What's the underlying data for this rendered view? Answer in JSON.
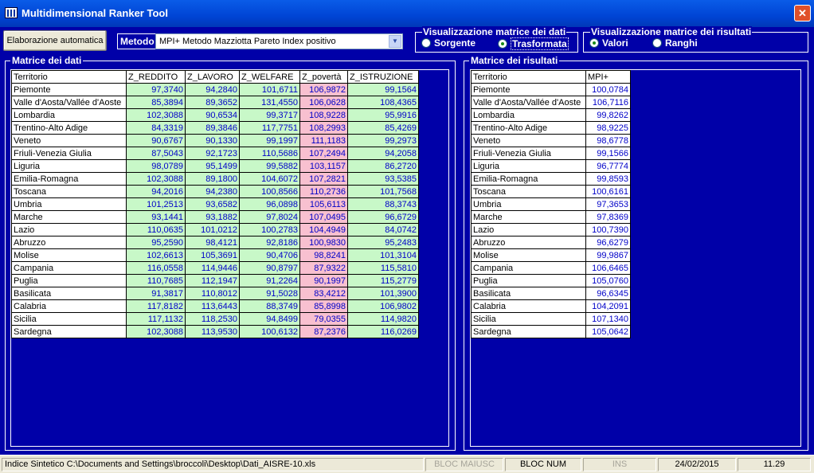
{
  "window": {
    "title": "Multidimensional Ranker Tool",
    "close_glyph": "✕"
  },
  "toolbar": {
    "auto_button": "Elaborazione automatica",
    "method_label": "Metodo",
    "method_value": "MPI+ Metodo Mazziotta Pareto Index positivo",
    "combo_arrow": "▼"
  },
  "view_data": {
    "title": "Visualizzazione matrice dei dati",
    "options": [
      {
        "label": "Sorgente",
        "selected": false
      },
      {
        "label": "Trasformata",
        "selected": true
      }
    ]
  },
  "view_results": {
    "title": "Visualizzazione matrice dei risultati",
    "options": [
      {
        "label": "Valori",
        "selected": true
      },
      {
        "label": "Ranghi",
        "selected": false
      }
    ]
  },
  "data_matrix": {
    "title": "Matrice dei dati",
    "headers": [
      "Territorio",
      "Z_REDDITO",
      "Z_LAVORO",
      "Z_WELFARE",
      "Z_povertà",
      "Z_ISTRUZIONE"
    ],
    "rows": [
      [
        "Piemonte",
        "97,3740",
        "94,2840",
        "101,6711",
        "106,9872",
        "99,1564"
      ],
      [
        "Valle d'Aosta/Vallée d'Aoste",
        "85,3894",
        "89,3652",
        "131,4550",
        "106,0628",
        "108,4365"
      ],
      [
        "Lombardia",
        "102,3088",
        "90,6534",
        "99,3717",
        "108,9228",
        "95,9916"
      ],
      [
        "Trentino-Alto Adige",
        "84,3319",
        "89,3846",
        "117,7751",
        "108,2993",
        "85,4269"
      ],
      [
        "Veneto",
        "90,6767",
        "90,1330",
        "99,1997",
        "111,1183",
        "99,2973"
      ],
      [
        "Friuli-Venezia Giulia",
        "87,5043",
        "92,1723",
        "110,5686",
        "107,2494",
        "94,2058"
      ],
      [
        "Liguria",
        "98,0789",
        "95,1499",
        "99,5882",
        "103,1157",
        "86,2720"
      ],
      [
        "Emilia-Romagna",
        "102,3088",
        "89,1800",
        "104,6072",
        "107,2821",
        "93,5385"
      ],
      [
        "Toscana",
        "94,2016",
        "94,2380",
        "100,8566",
        "110,2736",
        "101,7568"
      ],
      [
        "Umbria",
        "101,2513",
        "93,6582",
        "96,0898",
        "105,6113",
        "88,3743"
      ],
      [
        "Marche",
        "93,1441",
        "93,1882",
        "97,8024",
        "107,0495",
        "96,6729"
      ],
      [
        "Lazio",
        "110,0635",
        "101,0212",
        "100,2783",
        "104,4949",
        "84,0742"
      ],
      [
        "Abruzzo",
        "95,2590",
        "98,4121",
        "92,8186",
        "100,9830",
        "95,2483"
      ],
      [
        "Molise",
        "102,6613",
        "105,3691",
        "90,4706",
        "98,8241",
        "101,3104"
      ],
      [
        "Campania",
        "116,0558",
        "114,9446",
        "90,8797",
        "87,9322",
        "115,5810"
      ],
      [
        "Puglia",
        "110,7685",
        "112,1947",
        "91,2264",
        "90,1997",
        "115,2779"
      ],
      [
        "Basilicata",
        "91,3817",
        "110,8012",
        "91,5028",
        "83,4212",
        "101,3900"
      ],
      [
        "Calabria",
        "117,8182",
        "113,6443",
        "88,3749",
        "85,8998",
        "106,9802"
      ],
      [
        "Sicilia",
        "117,1132",
        "118,2530",
        "94,8499",
        "79,0355",
        "114,9820"
      ],
      [
        "Sardegna",
        "102,3088",
        "113,9530",
        "100,6132",
        "87,2376",
        "116,0269"
      ]
    ]
  },
  "results_matrix": {
    "title": "Matrice dei risultati",
    "headers": [
      "Territorio",
      "MPI+"
    ],
    "rows": [
      [
        "Piemonte",
        "100,0784"
      ],
      [
        "Valle d'Aosta/Vallée d'Aoste",
        "106,7116"
      ],
      [
        "Lombardia",
        "99,8262"
      ],
      [
        "Trentino-Alto Adige",
        "98,9225"
      ],
      [
        "Veneto",
        "98,6778"
      ],
      [
        "Friuli-Venezia Giulia",
        "99,1566"
      ],
      [
        "Liguria",
        "96,7774"
      ],
      [
        "Emilia-Romagna",
        "99,8593"
      ],
      [
        "Toscana",
        "100,6161"
      ],
      [
        "Umbria",
        "97,3653"
      ],
      [
        "Marche",
        "97,8369"
      ],
      [
        "Lazio",
        "100,7390"
      ],
      [
        "Abruzzo",
        "96,6279"
      ],
      [
        "Molise",
        "99,9867"
      ],
      [
        "Campania",
        "106,6465"
      ],
      [
        "Puglia",
        "105,0760"
      ],
      [
        "Basilicata",
        "96,6345"
      ],
      [
        "Calabria",
        "104,2091"
      ],
      [
        "Sicilia",
        "107,1340"
      ],
      [
        "Sardegna",
        "105,0642"
      ]
    ]
  },
  "status": {
    "file": "Indice Sintetico C:\\Documents and Settings\\broccoli\\Desktop\\Dati_AISRE-10.xls",
    "caps": "BLOC MAIUSC",
    "num": "BLOC NUM",
    "ins": "INS",
    "date": "24/02/2015",
    "time": "11.29"
  },
  "colors": {
    "background": "#0000a8",
    "value_text": "#0000c8",
    "green_cell": "#c8f8c8",
    "pink_cell": "#f8c0d0"
  }
}
